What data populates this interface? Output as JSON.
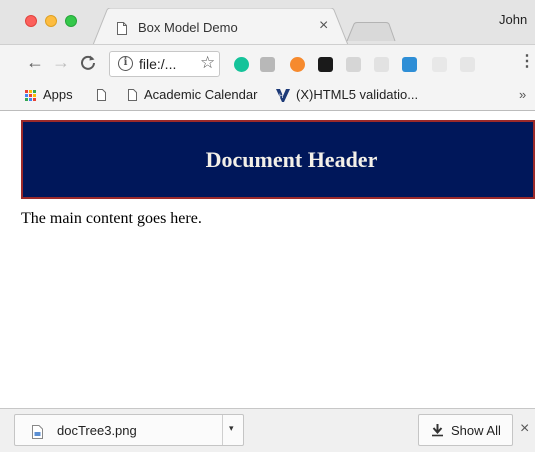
{
  "window": {
    "tab_title": "Box Model Demo",
    "tab_close": "×",
    "profile_name": "John"
  },
  "toolbar": {
    "back": "←",
    "forward": "→",
    "reload": "C",
    "url": "file:/...",
    "star": "☆",
    "menu": "⋮",
    "extensions": [
      {
        "name": "grammarly-icon",
        "color": "#15c39a"
      },
      {
        "name": "extension-gray-icon",
        "color": "#b8b8b8"
      },
      {
        "name": "orange-extension-icon",
        "color": "#f68a2e"
      },
      {
        "name": "vimeo-icon",
        "color": "#1a1a1a"
      },
      {
        "name": "extension-gray-icon-2",
        "color": "#d6d6d6"
      },
      {
        "name": "puzzle-extension-icon",
        "color": "#e2e2e2"
      },
      {
        "name": "blue-extension-icon",
        "color": "#2e8ed6"
      },
      {
        "name": "wifi-extension-icon",
        "color": "#e8e8e8"
      },
      {
        "name": "es-extension-icon",
        "color": "#e6e6e6"
      }
    ]
  },
  "bookmarks": {
    "apps": "Apps",
    "items": [
      "Academic Calendar",
      "(X)HTML5 validatio..."
    ],
    "overflow": "»"
  },
  "page": {
    "header_text": "Document Header",
    "main_text": "The main content goes here.",
    "header_bg": "#00175a",
    "header_border": "#9b2a2a"
  },
  "downloads": {
    "file_name": "docTree3.png",
    "caret": "▾",
    "show_all": "Show All",
    "close": "×"
  }
}
